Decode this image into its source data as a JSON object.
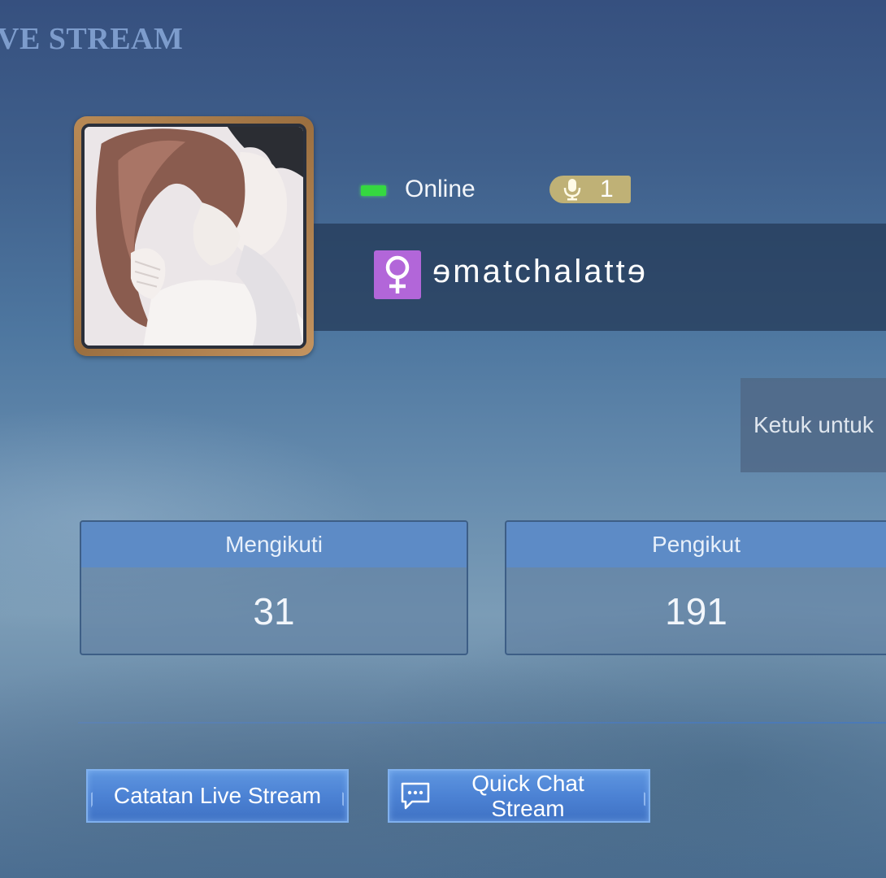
{
  "header": {
    "title": "VE STREAM"
  },
  "profile": {
    "avatar_icon": "profile-picture",
    "status_text": "Online",
    "status_color": "#35d840",
    "mic_count": "1",
    "gender_icon": "female-symbol",
    "gender_symbol": "♀",
    "gender_color": "#b266d9",
    "username": "ɘmatchalattɘ",
    "tap_hint": "Ketuk untuk"
  },
  "stats": [
    {
      "label": "Mengikuti",
      "value": "31"
    },
    {
      "label": "Pengikut",
      "value": "191"
    }
  ],
  "buttons": {
    "history_label": "Catatan Live Stream",
    "quick_chat_line1": "Quick Chat",
    "quick_chat_line2": "Stream"
  },
  "colors": {
    "accent_blue": "#5d8bc6",
    "avatar_frame": "#b98a55"
  }
}
